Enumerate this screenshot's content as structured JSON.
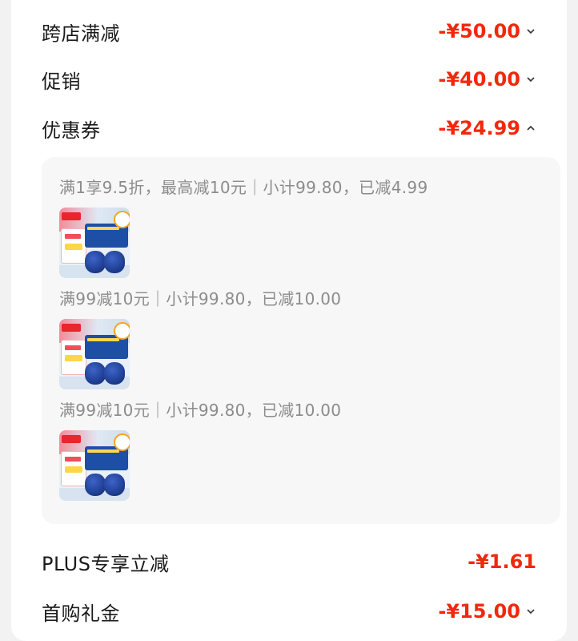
{
  "summary_rows": [
    {
      "label": "跨店满减",
      "amount": "-¥50.00",
      "chevron": "chevron-down-icon"
    },
    {
      "label": "促销",
      "amount": "-¥40.00",
      "chevron": "chevron-down-icon"
    },
    {
      "label": "优惠券",
      "amount": "-¥24.99",
      "chevron": "chevron-up-icon"
    }
  ],
  "coupon_details": [
    {
      "rule": "满1享9.5折，最高减10元｜小计99.80，已减4.99"
    },
    {
      "rule": "满99减10元｜小计99.80，已减10.00"
    },
    {
      "rule": "满99减10元｜小计99.80，已减10.00"
    }
  ],
  "bottom_rows": [
    {
      "label": "PLUS专享立减",
      "amount": "-¥1.61"
    },
    {
      "label": "首购礼金",
      "amount": "-¥15.00",
      "chevron": "chevron-down-icon"
    }
  ],
  "colors": {
    "accent_red": "#f2270c",
    "text_main": "#1a1a1a",
    "text_muted": "#8c8c8c"
  }
}
